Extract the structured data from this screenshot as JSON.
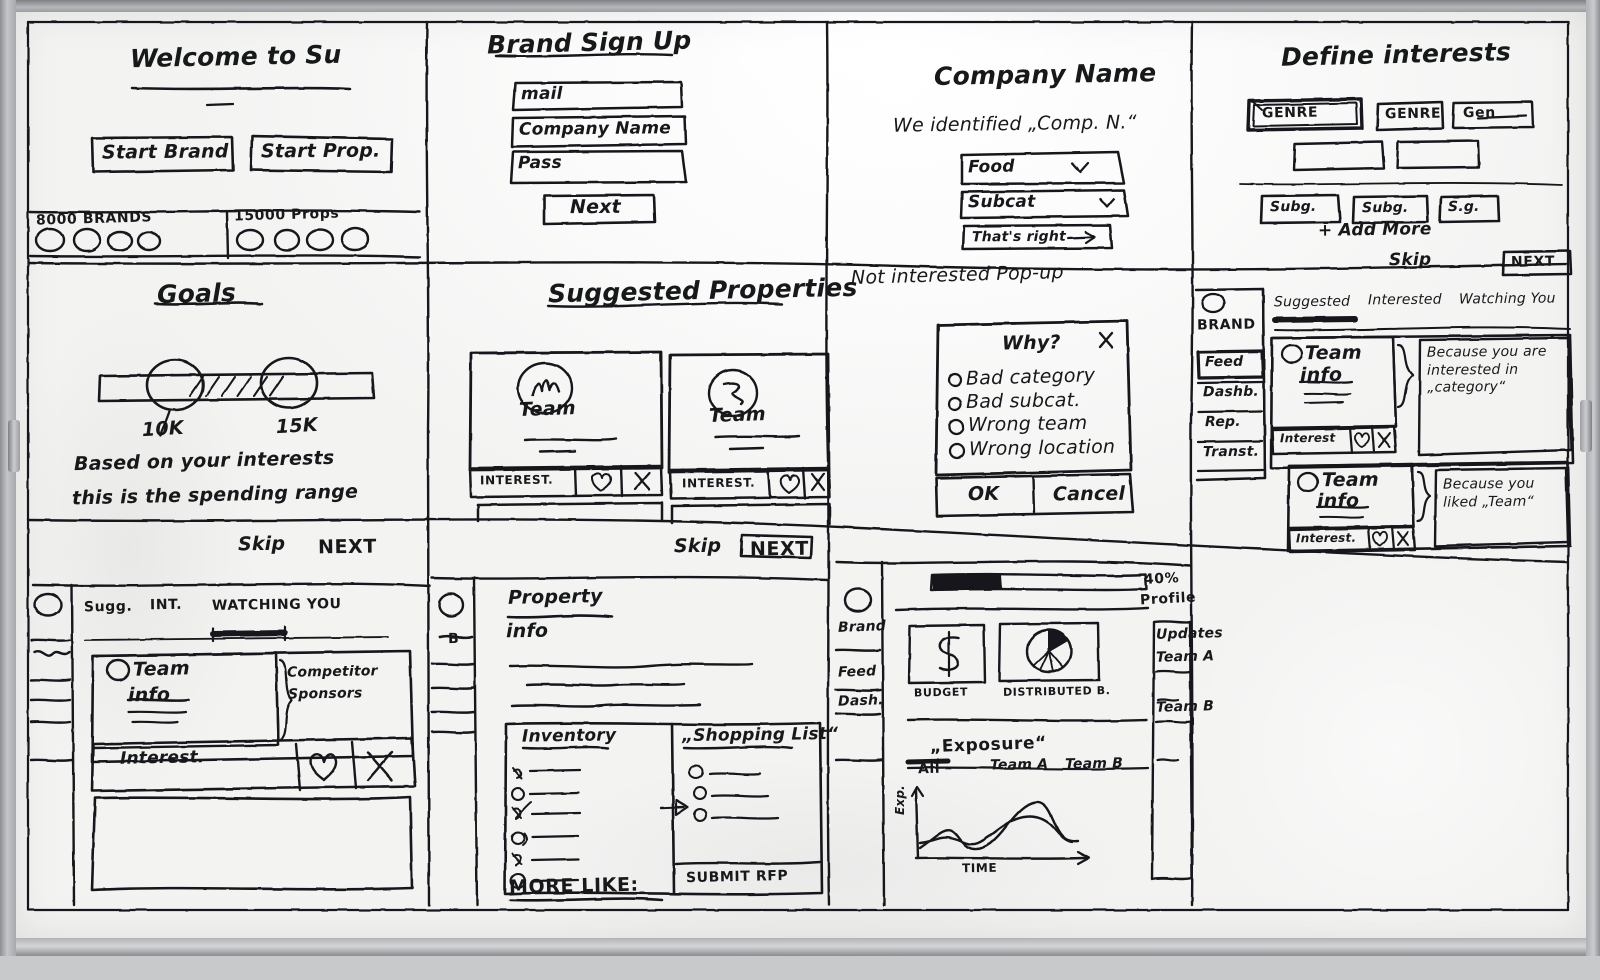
{
  "board": {
    "medium": "whiteboard-marker-sketch",
    "description": "Hand-drawn UX wireframe storyboard, 4 columns x 3 rows of screen sketches",
    "ink_color": "#16181a"
  },
  "panels": {
    "welcome": {
      "title": "Welcome to Su",
      "buttons": [
        "Start Brand",
        "Start Prop."
      ],
      "stats": [
        {
          "label": "8000 BRANDS",
          "dots": 4
        },
        {
          "label": "15000 Props",
          "dots": 4
        }
      ]
    },
    "brand_signup": {
      "title": "Brand Sign Up",
      "fields": [
        {
          "value": "mail"
        },
        {
          "value": "Company Name"
        },
        {
          "value": "Pass"
        }
      ],
      "next_label": "Next"
    },
    "company_name": {
      "title": "Company Name",
      "subtitle": "We identified „Comp. N.“",
      "selects": [
        {
          "value": "Food",
          "caret": "v"
        },
        {
          "value": "Subcat",
          "caret": "v"
        }
      ],
      "confirm_label": "That's right",
      "confirm_arrow": "→"
    },
    "define_interests": {
      "title": "Define interests",
      "genres": [
        "GENRE",
        "GENRE",
        "Gen"
      ],
      "genre_selected_index": 0,
      "empty_boxes": 2,
      "subgenres": [
        "Subg.",
        "Subg.",
        "S.g."
      ],
      "add_more": "+ Add More",
      "skip_label": "Skip",
      "next_label": "NEXT"
    },
    "goals": {
      "title": "Goals",
      "slider": {
        "min_handle_label": "10K",
        "max_handle_label": "15K"
      },
      "note_line1": "Based on your interests",
      "note_line2": "this is the spending range",
      "skip_label": "Skip",
      "next_label": "NEXT"
    },
    "suggested_properties": {
      "title": "Suggested Properties",
      "cards": [
        {
          "logo": "logo-mark-m",
          "name": "Team",
          "interest_label": "INTEREST.",
          "like_icon": "heart-icon",
          "dismiss_icon": "x-icon"
        },
        {
          "logo": "logo-mark-s",
          "name": "Team",
          "interest_label": "INTEREST.",
          "like_icon": "heart-icon",
          "dismiss_icon": "x-icon"
        }
      ],
      "skip_label": "Skip",
      "next_label": "NEXT"
    },
    "not_interested_popup": {
      "caption": "Not interested Pop-up",
      "dialog_title": "Why?",
      "close_icon": "x-icon",
      "options": [
        "Bad category",
        "Bad subcat.",
        "Wrong team",
        "Wrong location"
      ],
      "ok_label": "OK",
      "cancel_label": "Cancel"
    },
    "feed_right": {
      "sidebar": {
        "avatar": "circle-avatar",
        "brand_label": "BRAND",
        "items": [
          "Feed",
          "Dashb.",
          "Rep.",
          "Transt."
        ],
        "active_index": 0
      },
      "tabs": [
        "Suggested",
        "Interested",
        "Watching You"
      ],
      "active_tab_index": 0,
      "cards": [
        {
          "avatar": "circle-avatar",
          "title": "Team",
          "subtitle": "info",
          "interest_label": "Interest",
          "like_icon": "heart-icon",
          "dismiss_icon": "x-icon",
          "reason": "Because you are interested in „category“"
        },
        {
          "avatar": "circle-avatar",
          "title": "Team",
          "subtitle": "info",
          "interest_label": "Interest.",
          "like_icon": "heart-icon",
          "dismiss_icon": "x-icon",
          "reason": "Because you liked „Team“"
        }
      ]
    },
    "feed_bottom_left": {
      "sidebar": {
        "avatar": "circle-avatar",
        "items": 4
      },
      "tabs": [
        "Sugg.",
        "INT.",
        "WATCHING YOU"
      ],
      "active_tab_index": 2,
      "card": {
        "avatar": "circle-avatar",
        "title": "Team",
        "subtitle": "info",
        "interest_label": "Interest.",
        "like_icon": "heart-icon",
        "dismiss_icon": "x-icon",
        "side_label_line1": "Competitor",
        "side_label_line2": "Sponsors"
      }
    },
    "property_detail": {
      "sidebar": {
        "avatar": "circle-avatar",
        "brand_label": "B",
        "items": 4
      },
      "title": "Property",
      "subtitle": "info",
      "inventory": {
        "title": "Inventory",
        "rows": [
          {
            "checked": true
          },
          {
            "checked": false
          },
          {
            "checked": true
          },
          {
            "checked": false
          },
          {
            "checked": true
          },
          {
            "checked": false
          }
        ]
      },
      "shopping_list": {
        "title": "„Shopping List“",
        "rows": 3,
        "submit_label": "SUBMIT RFP"
      },
      "arrow_icon": "arrow-right-icon",
      "more_like_label": "MORE LIKE:"
    },
    "dashboard": {
      "sidebar": {
        "avatar": "circle-avatar",
        "brand_label": "Brand",
        "items": [
          "Feed",
          "Dash."
        ],
        "active_index": 1
      },
      "progress": {
        "label_line1": "40%",
        "label_line2": "Profile",
        "percent": 40
      },
      "kpis": [
        {
          "icon": "dollar-icon",
          "label": "BUDGET"
        },
        {
          "icon": "pie-chart-icon",
          "label": "DISTRIBUTED B."
        }
      ],
      "exposure": {
        "title": "„Exposure“",
        "tabs": [
          "All",
          "Team A",
          "Team B"
        ],
        "active_tab_index": 0,
        "ylabel": "Exp.",
        "xlabel": "TIME"
      },
      "updates": {
        "title": "Updates",
        "items": [
          "Team A",
          "Team B"
        ]
      }
    }
  },
  "chart_data": {
    "type": "line",
    "title": "Exposure",
    "xlabel": "TIME",
    "ylabel": "Exp.",
    "legend": [
      "Team A",
      "Team B"
    ],
    "legend_position": "top",
    "grid": false,
    "x": [
      0,
      1,
      2,
      3,
      4,
      5,
      6,
      7,
      8,
      9,
      10
    ],
    "series": [
      {
        "name": "Team A",
        "values": [
          12,
          34,
          40,
          22,
          20,
          26,
          46,
          66,
          62,
          40,
          38
        ]
      },
      {
        "name": "Team B",
        "values": [
          20,
          18,
          22,
          24,
          28,
          36,
          44,
          44,
          40,
          38,
          38
        ]
      }
    ],
    "ylim": [
      0,
      80
    ],
    "xlim": [
      0,
      10
    ]
  }
}
